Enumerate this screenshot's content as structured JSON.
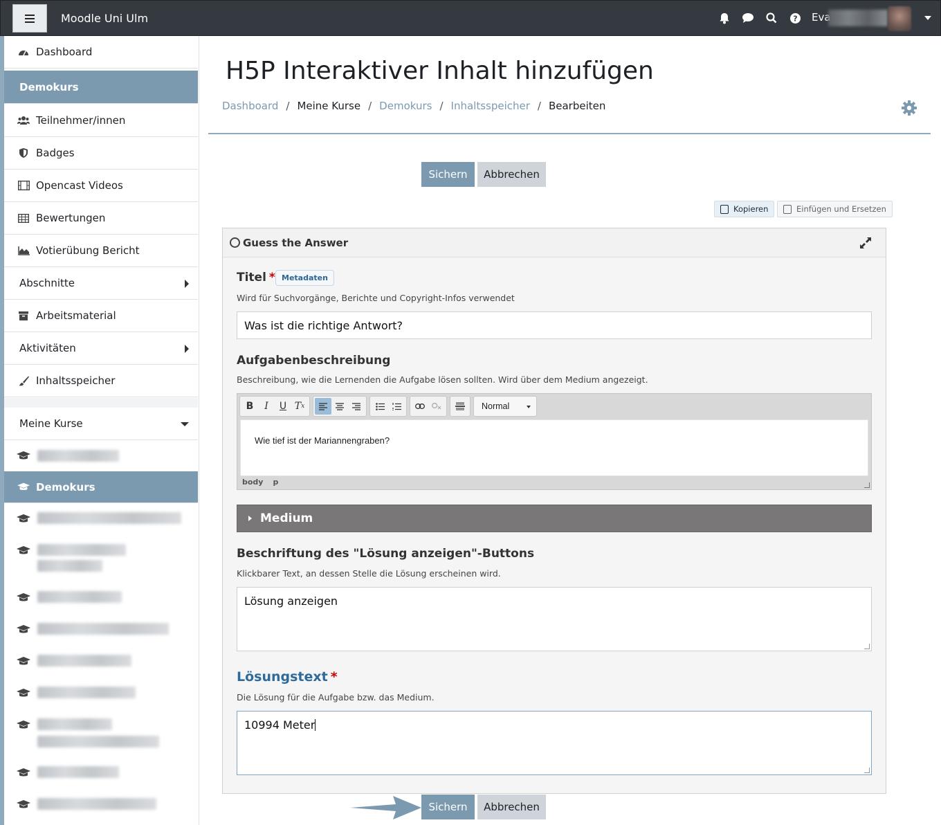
{
  "navbar": {
    "brand": "Moodle Uni Ulm",
    "user_name": "Eva"
  },
  "sidebar": {
    "items": [
      {
        "label": "Dashboard",
        "icon": "dashboard-icon"
      },
      {
        "label": "Demokurs"
      },
      {
        "label": "Teilnehmer/innen",
        "icon": "users-icon"
      },
      {
        "label": "Badges",
        "icon": "shield-icon"
      },
      {
        "label": "Opencast Videos",
        "icon": "film-icon"
      },
      {
        "label": "Bewertungen",
        "icon": "table-icon"
      },
      {
        "label": "Votierübung Bericht",
        "icon": "area-chart-icon"
      },
      {
        "label": "Abschnitte"
      },
      {
        "label": "Arbeitsmaterial",
        "icon": "archive-icon"
      },
      {
        "label": "Aktivitäten"
      },
      {
        "label": "Inhaltsspeicher",
        "icon": "brush-icon"
      }
    ],
    "my_courses": "Meine Kurse",
    "active_course": "Demokurs"
  },
  "page": {
    "title": "H5P Interaktiver Inhalt hinzufügen",
    "breadcrumb": [
      "Dashboard",
      "Meine Kurse",
      "Demokurs",
      "Inhaltsspeicher",
      "Bearbeiten"
    ]
  },
  "actions": {
    "save": "Sichern",
    "cancel": "Abbrechen",
    "copy": "Kopieren",
    "paste_replace": "Einfügen und Ersetzen"
  },
  "editor": {
    "content_type": "Guess the Answer",
    "title_label": "Titel",
    "metadata": "Metadaten",
    "title_desc": "Wird für Suchvorgänge, Berichte und Copyright-Infos verwendet",
    "title_value": "Was ist die richtige Antwort?",
    "task_label": "Aufgabenbeschreibung",
    "task_desc": "Beschreibung, wie die Lernenden die Aufgabe lösen sollten. Wird über dem Medium angezeigt.",
    "task_value": "Wie tief ist der Mariannengraben?",
    "format": "Normal",
    "path": [
      "body",
      "p"
    ],
    "medium": "Medium",
    "button_label": "Beschriftung des \"Lösung anzeigen\"-Buttons",
    "button_desc": "Klickbarer Text, an dessen Stelle die Lösung erscheinen wird.",
    "button_value": "Lösung anzeigen",
    "solution_label": "Lösungstext",
    "solution_desc": "Die Lösung für die Aufgabe bzw. das Medium.",
    "solution_value": "10994 Meter"
  },
  "colors": {
    "navbar": "#343a40",
    "primary": "#7b9ab0",
    "secondary": "#ced4da",
    "required": "#cc0000"
  }
}
